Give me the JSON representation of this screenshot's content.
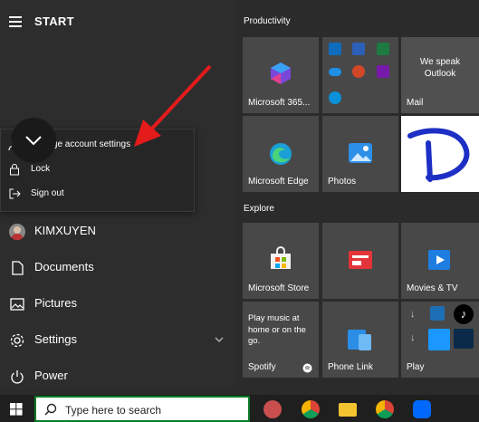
{
  "start_menu": {
    "title": "START",
    "user": {
      "name": "KIMXUYEN"
    },
    "nav": [
      {
        "label": "Documents",
        "icon": "document-icon"
      },
      {
        "label": "Pictures",
        "icon": "picture-icon"
      },
      {
        "label": "Settings",
        "icon": "gear-icon"
      },
      {
        "label": "Power",
        "icon": "power-icon"
      }
    ]
  },
  "account_popup": {
    "items": [
      {
        "label": "Change account settings",
        "icon": "person-settings-icon"
      },
      {
        "label": "Lock",
        "icon": "lock-icon"
      },
      {
        "label": "Sign out",
        "icon": "sign-out-icon"
      }
    ]
  },
  "tiles": {
    "productivity_label": "Productivity",
    "explore_label": "Explore",
    "microsoft365": "Microsoft 365...",
    "mail_promo": "We speak Outlook",
    "mail": "Mail",
    "edge": "Microsoft Edge",
    "photos": "Photos",
    "store": "Microsoft Store",
    "movies": "Movies & TV",
    "spotify_promo": "Play music at home or on the go.",
    "spotify": "Spotify",
    "phone_link": "Phone Link",
    "play": "Play"
  },
  "taskbar": {
    "search_placeholder": "Type here to search"
  },
  "colors": {
    "accent_green": "#0a7a27",
    "arrow_red": "#e31b1b",
    "disney_blue": "#1d2fc4"
  }
}
